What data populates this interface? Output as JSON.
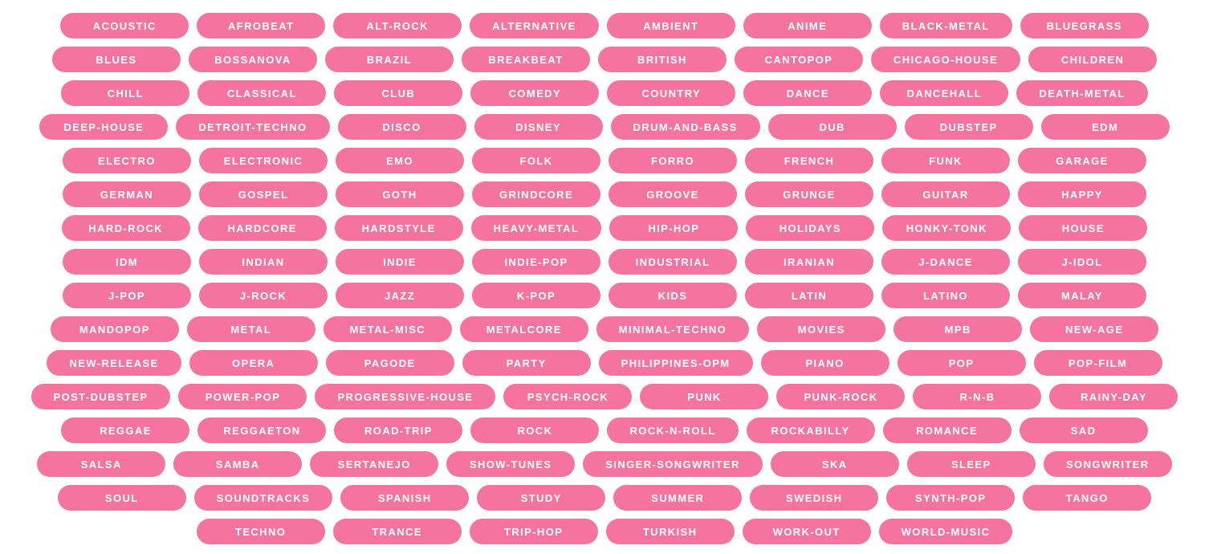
{
  "colors": {
    "pill_background": "#f4749f",
    "pill_text": "#ffffff",
    "page_background": "#ffffff"
  },
  "genres": [
    "ACOUSTIC",
    "AFROBEAT",
    "ALT-ROCK",
    "ALTERNATIVE",
    "AMBIENT",
    "ANIME",
    "BLACK-METAL",
    "BLUEGRASS",
    "BLUES",
    "BOSSANOVA",
    "BRAZIL",
    "BREAKBEAT",
    "BRITISH",
    "CANTOPOP",
    "CHICAGO-HOUSE",
    "CHILDREN",
    "CHILL",
    "CLASSICAL",
    "CLUB",
    "COMEDY",
    "COUNTRY",
    "DANCE",
    "DANCEHALL",
    "DEATH-METAL",
    "DEEP-HOUSE",
    "DETROIT-TECHNO",
    "DISCO",
    "DISNEY",
    "DRUM-AND-BASS",
    "DUB",
    "DUBSTEP",
    "EDM",
    "ELECTRO",
    "ELECTRONIC",
    "EMO",
    "FOLK",
    "FORRO",
    "FRENCH",
    "FUNK",
    "GARAGE",
    "GERMAN",
    "GOSPEL",
    "GOTH",
    "GRINDCORE",
    "GROOVE",
    "GRUNGE",
    "GUITAR",
    "HAPPY",
    "HARD-ROCK",
    "HARDCORE",
    "HARDSTYLE",
    "HEAVY-METAL",
    "HIP-HOP",
    "HOLIDAYS",
    "HONKY-TONK",
    "HOUSE",
    "IDM",
    "INDIAN",
    "INDIE",
    "INDIE-POP",
    "INDUSTRIAL",
    "IRANIAN",
    "J-DANCE",
    "J-IDOL",
    "J-POP",
    "J-ROCK",
    "JAZZ",
    "K-POP",
    "KIDS",
    "LATIN",
    "LATINO",
    "MALAY",
    "MANDOPOP",
    "METAL",
    "METAL-MISC",
    "METALCORE",
    "MINIMAL-TECHNO",
    "MOVIES",
    "MPB",
    "NEW-AGE",
    "NEW-RELEASE",
    "OPERA",
    "PAGODE",
    "PARTY",
    "PHILIPPINES-OPM",
    "PIANO",
    "POP",
    "POP-FILM",
    "POST-DUBSTEP",
    "POWER-POP",
    "PROGRESSIVE-HOUSE",
    "PSYCH-ROCK",
    "PUNK",
    "PUNK-ROCK",
    "R-N-B",
    "RAINY-DAY",
    "REGGAE",
    "REGGAETON",
    "ROAD-TRIP",
    "ROCK",
    "ROCK-N-ROLL",
    "ROCKABILLY",
    "ROMANCE",
    "SAD",
    "SALSA",
    "SAMBA",
    "SERTANEJO",
    "SHOW-TUNES",
    "SINGER-SONGWRITER",
    "SKA",
    "SLEEP",
    "SONGWRITER",
    "SOUL",
    "SOUNDTRACKS",
    "SPANISH",
    "STUDY",
    "SUMMER",
    "SWEDISH",
    "SYNTH-POP",
    "TANGO",
    "TECHNO",
    "TRANCE",
    "TRIP-HOP",
    "TURKISH",
    "WORK-OUT",
    "WORLD-MUSIC"
  ]
}
